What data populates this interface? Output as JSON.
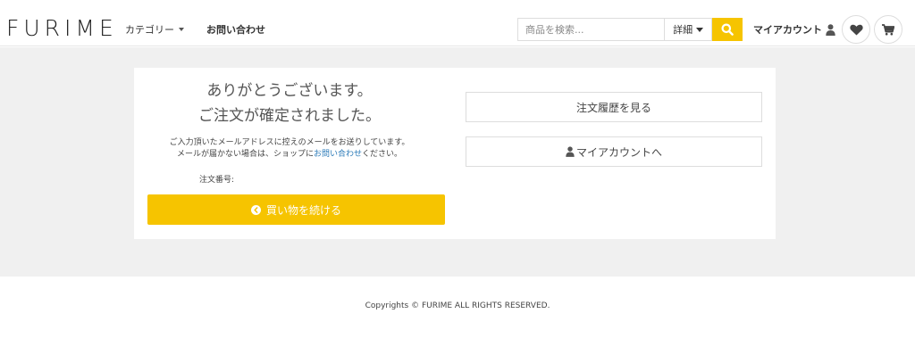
{
  "header": {
    "logo": "FURIME",
    "nav": {
      "category_label": "カテゴリー",
      "contact_label": "お問い合わせ"
    },
    "search": {
      "placeholder": "商品を検索...",
      "detail_label": "詳細"
    },
    "my_account_label": "マイアカウント"
  },
  "main": {
    "thanks_line1": "ありがとうございます。",
    "thanks_line2": "ご注文が確定されました。",
    "desc_line1": "ご入力頂いたメールアドレスに控えのメールをお送りしています。",
    "desc_line2_prefix": "メールが届かない場合は、ショップに",
    "desc_line2_link": "お問い合わせ",
    "desc_line2_suffix": "ください。",
    "order_number_label": "注文番号:",
    "continue_label": "買い物を続ける",
    "order_history_label": "注文履歴を見る",
    "to_my_account_label": "マイアカウントへ"
  },
  "footer": {
    "copyright": "Copyrights © FURIME ALL RIGHTS RESERVED."
  },
  "colors": {
    "accent": "#f6c400",
    "link": "#2a7ab8",
    "page_bg": "#f0f0f0"
  },
  "icons": [
    "search-icon",
    "user-icon",
    "heart-icon",
    "cart-icon",
    "chevron-left-circle-icon",
    "caret-down-icon"
  ]
}
